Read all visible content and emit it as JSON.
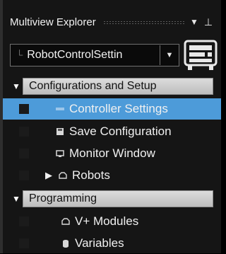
{
  "window": {
    "title": "Multiview Explorer"
  },
  "selector": {
    "value": "RobotControlSettin"
  },
  "tree": {
    "config_header": "Configurations and Setup",
    "items": [
      {
        "label": "Controller Settings",
        "icon": "controller-settings-icon"
      },
      {
        "label": "Save Configuration",
        "icon": "save-icon"
      },
      {
        "label": "Monitor Window",
        "icon": "monitor-icon"
      },
      {
        "label": "Robots",
        "icon": "folder-icon"
      }
    ],
    "programming_header": "Programming",
    "prog_items": [
      {
        "label": "V+ Modules",
        "icon": "folder-icon"
      },
      {
        "label": "Variables",
        "icon": "variables-icon"
      }
    ]
  },
  "colors": {
    "selection": "#4d9bd9",
    "header": "#d0d0d0",
    "background": "#151515"
  }
}
